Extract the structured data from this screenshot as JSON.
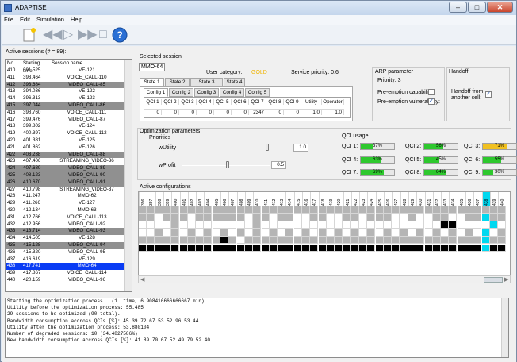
{
  "window": {
    "title": "ADAPTISE"
  },
  "menu": [
    "File",
    "Edit",
    "Simulation",
    "Help"
  ],
  "toolbar": {
    "icons": [
      "new-document-icon",
      "rewind-icon",
      "play-icon",
      "fast-forward-icon",
      "stop-icon",
      "help-icon"
    ]
  },
  "sessions": {
    "title": "Active sessions (# = 89):",
    "columns": [
      "No.",
      "Starting time",
      "Session name"
    ],
    "rows": [
      [
        "410",
        "391.525",
        "VE-121"
      ],
      [
        "411",
        "393.464",
        "VOICE_CALL-110"
      ],
      [
        "412",
        "393.684",
        "VIDEO_CALL-85"
      ],
      [
        "413",
        "394.036",
        "VE-122"
      ],
      [
        "414",
        "396.313",
        "VE-123"
      ],
      [
        "415",
        "397.044",
        "VIDEO_CALL-86"
      ],
      [
        "416",
        "398.760",
        "VOICE_CALL-111"
      ],
      [
        "417",
        "399.476",
        "VIDEO_CALL-87"
      ],
      [
        "418",
        "399.802",
        "VE-124"
      ],
      [
        "419",
        "400.397",
        "VOICE_CALL-112"
      ],
      [
        "420",
        "401.381",
        "VE-125"
      ],
      [
        "421",
        "401.862",
        "VE-126"
      ],
      [
        "422",
        "403.238",
        "VIDEO_CALL-88"
      ],
      [
        "423",
        "407.406",
        "STREAMING_VIDEO-36"
      ],
      [
        "424",
        "407.680",
        "VIDEO_CALL-89"
      ],
      [
        "425",
        "408.123",
        "VIDEO_CALL-90"
      ],
      [
        "426",
        "410.670",
        "VIDEO_CALL-91"
      ],
      [
        "427",
        "410.798",
        "STREAMING_VIDEO-37"
      ],
      [
        "428",
        "411.247",
        "MMO-62"
      ],
      [
        "429",
        "411.266",
        "VE-127"
      ],
      [
        "430",
        "412.134",
        "MMO-63"
      ],
      [
        "431",
        "412.766",
        "VOICE_CALL-113"
      ],
      [
        "432",
        "412.956",
        "VIDEO_CALL-92"
      ],
      [
        "433",
        "413.714",
        "VIDEO_CALL-93"
      ],
      [
        "434",
        "414.505",
        "VE-128"
      ],
      [
        "435",
        "415.128",
        "VIDEO_CALL-94"
      ],
      [
        "436",
        "415.320",
        "VIDEO_CALL-95"
      ],
      [
        "437",
        "416.619",
        "VE-129"
      ],
      [
        "438",
        "417.741",
        "MMO-64"
      ],
      [
        "439",
        "417.867",
        "VOICE_CALL-114"
      ],
      [
        "440",
        "420.159",
        "VIDEO_CALL-96"
      ]
    ],
    "dark_rows": [
      2,
      5,
      12,
      14,
      15,
      16,
      23,
      25
    ],
    "selected_row": 28
  },
  "selected_session": {
    "label": "Selected session",
    "name": "MMO-64",
    "user_category_label": "User category:",
    "user_category": "GOLD",
    "service_priority": "Service priority: 0.6",
    "state_tabs": [
      "State 1",
      "State 2",
      "State 3 [Active]",
      "State 4"
    ],
    "config_tabs": [
      "Config 1",
      "Config 2",
      "Config 3",
      "Config 4",
      "Config 5"
    ],
    "table_headers": [
      "QCI 1",
      "QCI 2",
      "QCI 3",
      "QCI 4",
      "QCI 5",
      "QCI 6",
      "QCI 7",
      "QCI 8",
      "QCI 9",
      "Utility",
      "Operator"
    ],
    "table_values": [
      "0",
      "0",
      "0",
      "0",
      "0",
      "0",
      "2347",
      "0",
      "0",
      "1.0",
      "1.0"
    ]
  },
  "arp": {
    "title": "ARP parameter",
    "priority": "Priority: 3",
    "capability_label": "Pre-emption capability:",
    "capability_checked": false,
    "vulnerability_label": "Pre-emption vulnerability:",
    "vulnerability_checked": true
  },
  "handoff": {
    "title": "Handoff",
    "label_line1": "Handoff from",
    "label_line2": "another cell:",
    "checked": true
  },
  "optimization": {
    "title": "Optimization parameters",
    "priorities": "Priorities",
    "wutility_label": "wUtility",
    "wutility": "1.0",
    "wprofit_label": "wProfit",
    "wprofit": "0.5",
    "qci_usage_title": "QCI usage",
    "qci": [
      {
        "label": "QCI 1:",
        "pct": 37,
        "text": "37%",
        "color": "#2ec82e"
      },
      {
        "label": "QCI 2:",
        "pct": 56,
        "text": "56%",
        "color": "#2ec82e"
      },
      {
        "label": "QCI 3:",
        "pct": 71,
        "text": "71%",
        "color": "#f0c020"
      },
      {
        "label": "QCI 4:",
        "pct": 63,
        "text": "63%",
        "color": "#2ec82e"
      },
      {
        "label": "QCI 5:",
        "pct": 45,
        "text": "45%",
        "color": "#2ec82e"
      },
      {
        "label": "QCI 6:",
        "pct": 55,
        "text": "55%",
        "color": "#2ec82e"
      },
      {
        "label": "QCI 7:",
        "pct": 69,
        "text": "69%",
        "color": "#2ec82e"
      },
      {
        "label": "QCI 8:",
        "pct": 64,
        "text": "64%",
        "color": "#2ec82e"
      },
      {
        "label": "QCI 9:",
        "pct": 30,
        "text": "30%",
        "color": "#2ec82e"
      }
    ]
  },
  "configs": {
    "title": "Active configurations",
    "columns": [
      "396",
      "397",
      "398",
      "399",
      "400",
      "401",
      "402",
      "403",
      "404",
      "405",
      "406",
      "407",
      "408",
      "409",
      "410",
      "411",
      "412",
      "413",
      "414",
      "415",
      "416",
      "417",
      "418",
      "419",
      "420",
      "421",
      "422",
      "423",
      "424",
      "425",
      "426",
      "427",
      "428",
      "429",
      "430",
      "431",
      "432",
      "433",
      "434",
      "435",
      "436",
      "437",
      "438",
      "439",
      "440"
    ],
    "highlight_column": 42,
    "highlight_color": "#00d8f0",
    "rows": [
      "GGGGGGGGGGGGGGGGGGGGGGGGGGGGGGGGGGGGGGGGGGGGG",
      "GGWGGGWGGGGGGWGGWGGWWGGWWGGWGGGWWGWWGGWWGGCGG",
      "WWWWGWWWWWWWWWGWWWWWWWWWWWWWWWWWWWWWWBBWWWWCW",
      "WWGWGWGWGWGWGWGWGWGWGWGWGWGWGWGWGWGWGWGWGWCWG",
      "GGGGGGGGGGBGWGGGGGGGGGGGGGGGGGGGGGGGGGGGGGCGG",
      "BBBBBBBBBBBBBBBBBBBBBBBBBBBBBBBBBBBBBBBBBBCBB"
    ]
  },
  "console": {
    "lines": [
      "Starting the optimization process...(1. time, 6.908416666666667 min)",
      "Utility before the optimization process: 55.485",
      "29 sessions to be optimized (90 total).",
      "Bandwidth consumption accross QCIs [%]: 45 39 72 67 53 52 96 53 44",
      "Utility after the optimization process: 53.880104",
      "Number of degraded sessions: 10 (34.4827586%)",
      "New bandwidth consumption accross QCIs [%]: 41 89 70 67 52 49 79 52 40"
    ]
  }
}
